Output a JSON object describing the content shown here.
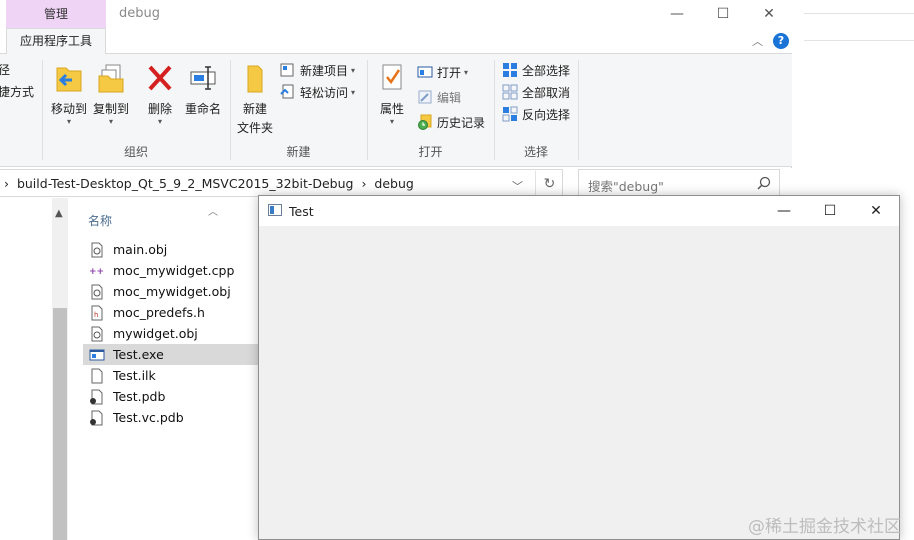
{
  "explorer": {
    "contextual_tab_header": "管理",
    "window_title": "debug",
    "window_buttons": {
      "minimize": "—",
      "maximize": "☐",
      "close": "✕"
    },
    "ribbon_tab_active": "应用程序工具",
    "left_partial_1": "径",
    "left_partial_2": "捷方式",
    "groups": {
      "organize": {
        "label": "组织",
        "move_to": "移动到",
        "copy_to": "复制到",
        "delete": "删除",
        "rename": "重命名"
      },
      "new": {
        "label": "新建",
        "new_folder_1": "新建",
        "new_folder_2": "文件夹",
        "new_item": "新建项目",
        "easy_access": "轻松访问"
      },
      "open": {
        "label": "打开",
        "properties": "属性",
        "open": "打开",
        "edit": "编辑",
        "history": "历史记录"
      },
      "select": {
        "label": "选择",
        "select_all": "全部选择",
        "select_none": "全部取消",
        "invert": "反向选择"
      }
    },
    "address": {
      "sep0": "›",
      "seg1": "build-Test-Desktop_Qt_5_9_2_MSVC2015_32bit-Debug",
      "sep1": "›",
      "seg2": "debug"
    },
    "search_placeholder": "搜索\"debug\"",
    "column_name": "名称",
    "files": [
      {
        "name": "main.obj",
        "icon": "obj-file-icon"
      },
      {
        "name": "moc_mywidget.cpp",
        "icon": "cpp-file-icon"
      },
      {
        "name": "moc_mywidget.obj",
        "icon": "obj-file-icon"
      },
      {
        "name": "moc_predefs.h",
        "icon": "header-file-icon"
      },
      {
        "name": "mywidget.obj",
        "icon": "obj-file-icon"
      },
      {
        "name": "Test.exe",
        "icon": "exe-file-icon",
        "selected": true
      },
      {
        "name": "Test.ilk",
        "icon": "ilk-file-icon"
      },
      {
        "name": "Test.pdb",
        "icon": "pdb-file-icon"
      },
      {
        "name": "Test.vc.pdb",
        "icon": "pdb-file-icon"
      }
    ]
  },
  "test_window": {
    "title": "Test",
    "buttons": {
      "minimize": "—",
      "maximize": "☐",
      "close": "✕"
    }
  },
  "watermark": "@稀土掘金技术社区",
  "colors": {
    "contextual_tab": "#f0d4f5",
    "ribbon_bg": "#f5f6f7",
    "selected_row": "#d9d9d9",
    "help_blue": "#1a73d6",
    "delete_red": "#d42020"
  }
}
